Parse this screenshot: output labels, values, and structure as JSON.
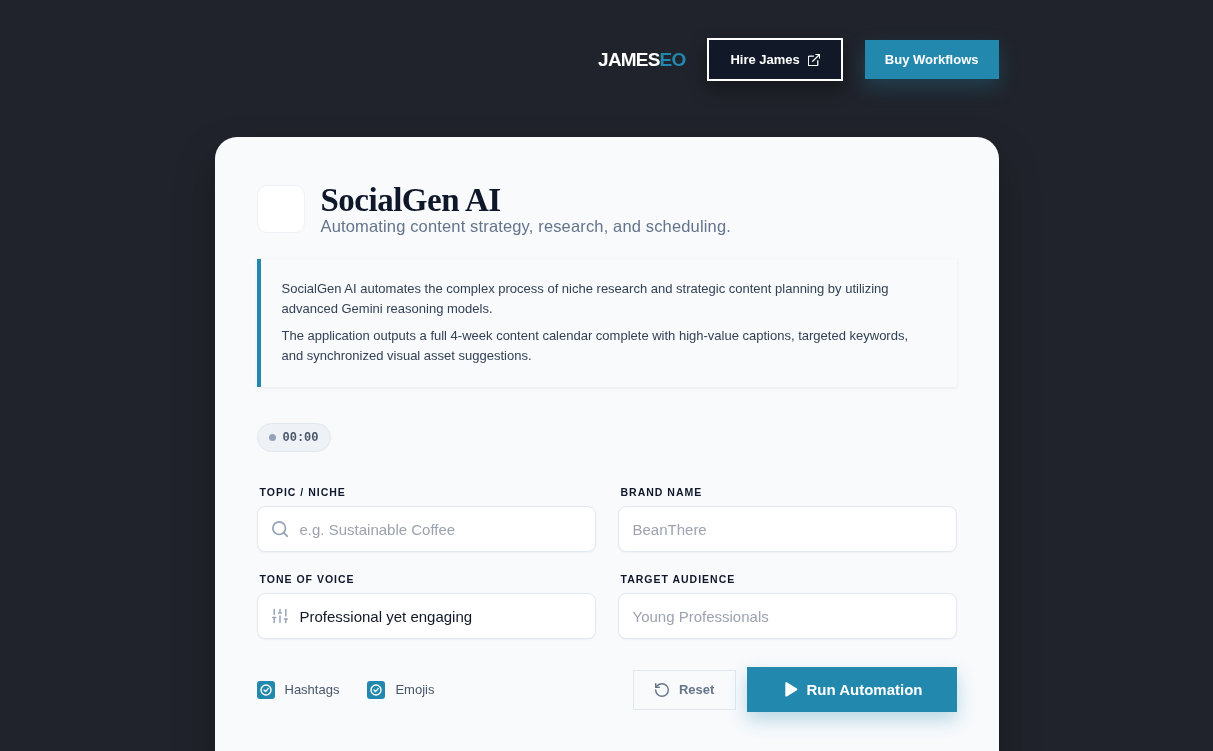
{
  "header": {
    "logo": {
      "text": "JAMES",
      "accent": "EO"
    },
    "buttons": [
      {
        "label": "Hire James",
        "kind": "outline"
      },
      {
        "label": "Buy Workflows",
        "kind": "filled"
      }
    ]
  },
  "card": {
    "title": "SocialGen AI",
    "subtitle": "Automating content strategy, research, and scheduling.",
    "description": [
      "SocialGen AI automates the complex process of niche research and strategic content planning by utilizing advanced Gemini reasoning models.",
      "The application outputs a full 4-week content calendar complete with high-value captions, targeted keywords, and synchronized visual asset suggestions."
    ],
    "timer": {
      "time": "00:00",
      "running": false
    },
    "fields": [
      {
        "label": "TOPIC / NICHE",
        "kind": "search",
        "placeholder": "e.g. Sustainable Coffee"
      },
      {
        "label": "BRAND NAME",
        "kind": "text",
        "placeholder": "BeanThere"
      },
      {
        "label": "TONE OF VOICE",
        "kind": "preset",
        "value": "Professional yet engaging"
      },
      {
        "label": "TARGET AUDIENCE",
        "kind": "text",
        "placeholder": "Young Professionals"
      }
    ],
    "options": [
      {
        "label": "Hashtags",
        "checked": true
      },
      {
        "label": "Emojis",
        "checked": true
      }
    ],
    "actions": [
      {
        "label": "Reset",
        "kind": "secondary"
      },
      {
        "label": "Run Automation",
        "kind": "primary"
      }
    ]
  }
}
